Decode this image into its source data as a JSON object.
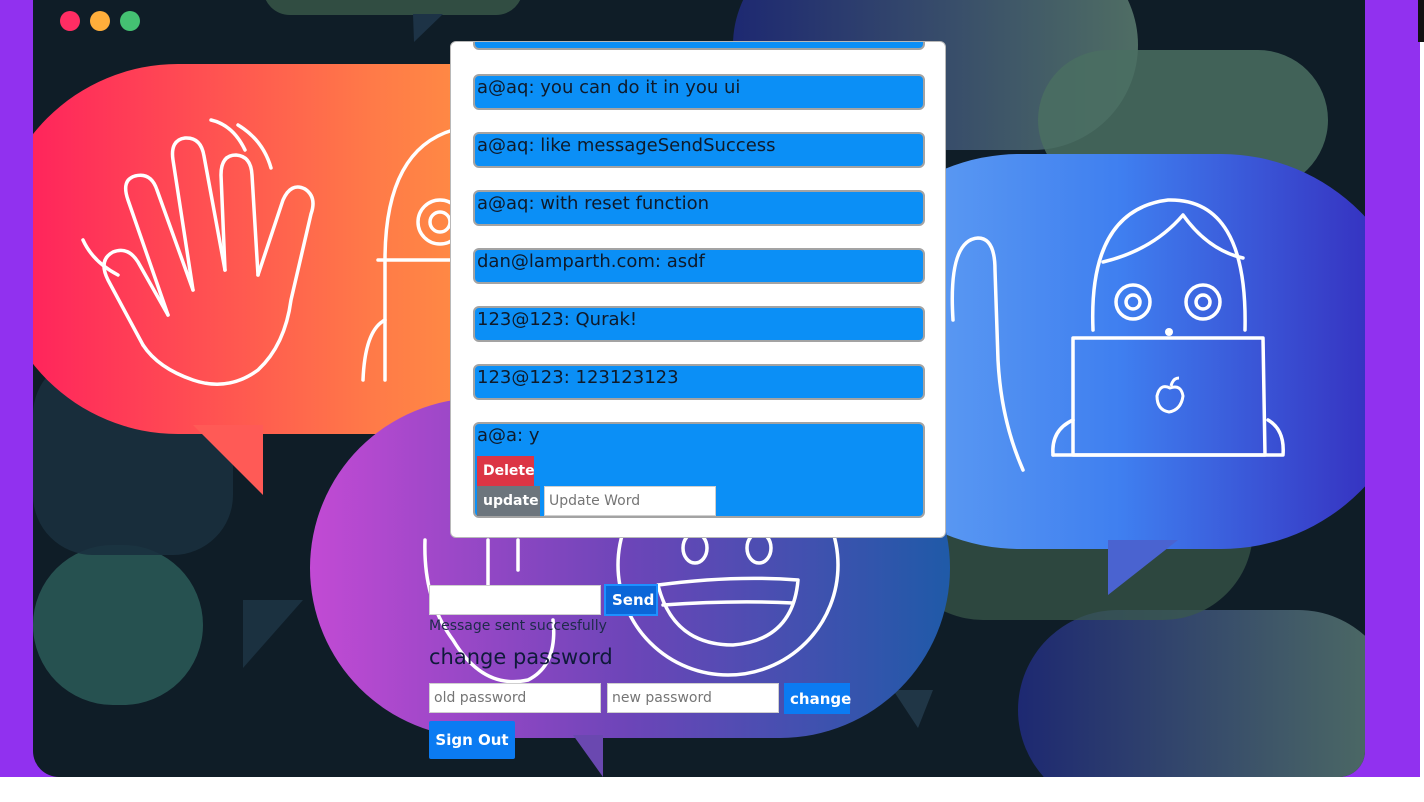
{
  "window": {
    "traffic_lights": [
      "#ff2d63",
      "#ffae3b",
      "#44c172"
    ]
  },
  "chat": {
    "messages": [
      {
        "text": "a@aq: you can do it in you ui"
      },
      {
        "text": "a@aq: like messageSendSuccess"
      },
      {
        "text": "a@aq: with reset function"
      },
      {
        "text": "dan@lamparth.com: asdf"
      },
      {
        "text": "123@123: Qurak!"
      },
      {
        "text": "123@123: 123123123"
      },
      {
        "text": "a@a: y"
      }
    ],
    "delete_label": "Delete",
    "update_label": "update",
    "update_placeholder": "Update Word"
  },
  "composer": {
    "send_label": "Send",
    "status": "Message sent succesfully"
  },
  "password": {
    "title": "change password",
    "old_placeholder": "old password",
    "new_placeholder": "new password",
    "change_label": "change"
  },
  "signout_label": "Sign Out",
  "colors": {
    "page_bg": "#9131ef",
    "window_bg": "#0f1d27",
    "message_bg": "#0b8ff6",
    "delete": "#dc3545",
    "update": "#6c757d",
    "primary": "#0b7bf2"
  }
}
